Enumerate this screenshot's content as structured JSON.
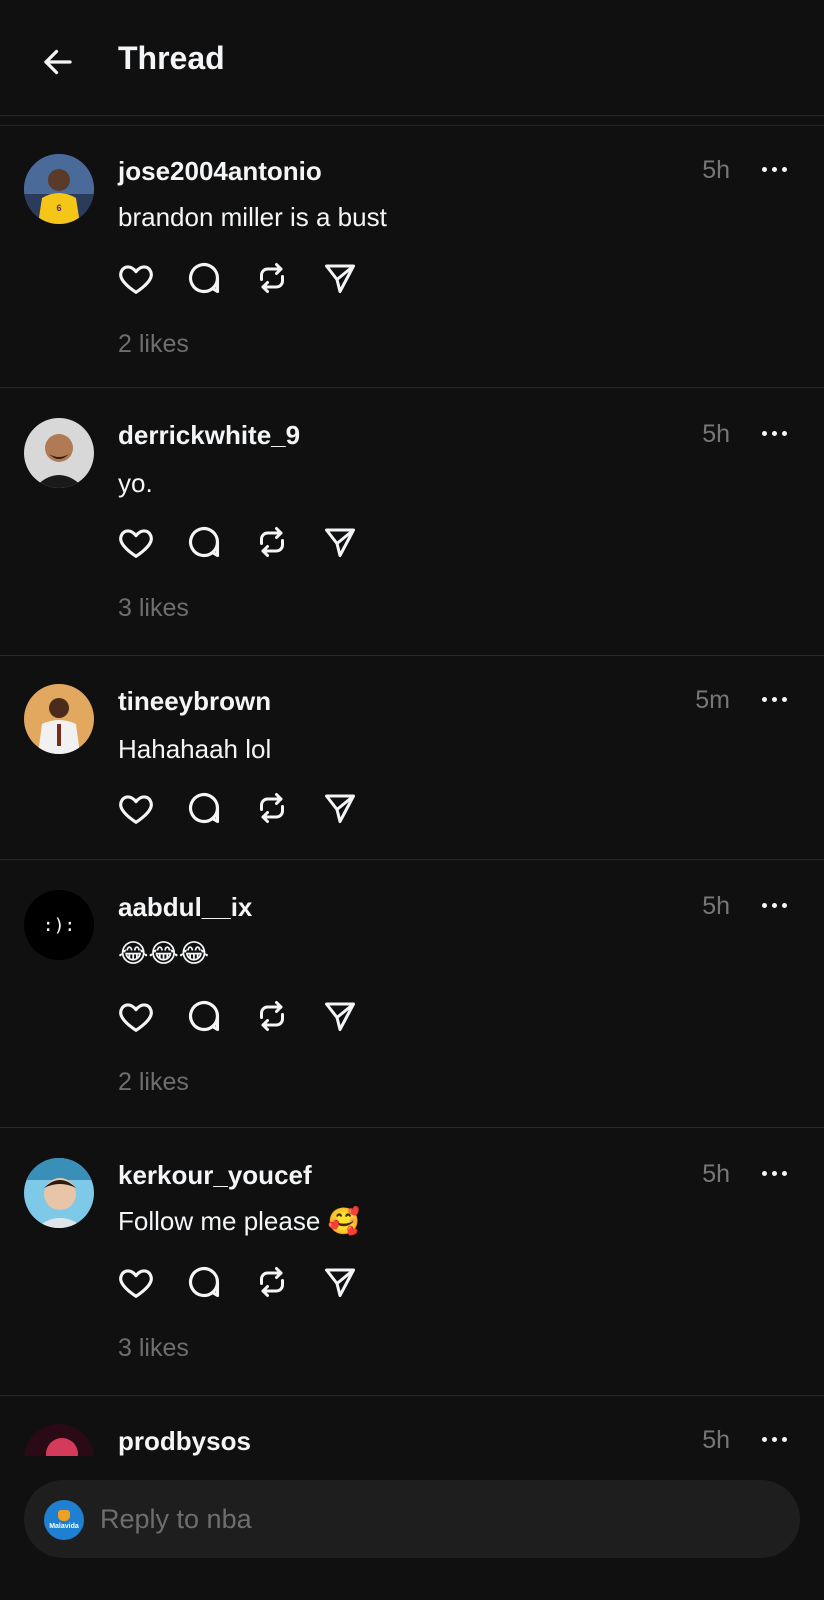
{
  "header": {
    "title": "Thread"
  },
  "posts": [
    {
      "username": "jose2004antonio",
      "time": "5h",
      "text": "brandon miller is a bust",
      "likes": "2 likes"
    },
    {
      "username": "derrickwhite_9",
      "time": "5h",
      "text": "yo.",
      "likes": "3 likes"
    },
    {
      "username": "tineeybrown",
      "time": "5m",
      "text": "Hahahaah lol",
      "likes": ""
    },
    {
      "username": "aabdul__ix",
      "time": "5h",
      "text": "😂😂😂",
      "likes": "2 likes",
      "avatar_text": ":):"
    },
    {
      "username": "kerkour_youcef",
      "time": "5h",
      "text": "Follow me please 🥰",
      "likes": "3 likes"
    },
    {
      "username": "prodbysos",
      "time": "5h",
      "text": "",
      "likes": ""
    }
  ],
  "reply": {
    "placeholder": "Reply to nba",
    "avatar_logo_text": "Malavida"
  },
  "icons": {
    "back": "arrow-left-icon",
    "more": "more-dots-icon",
    "like": "heart-icon",
    "comment": "comment-bubble-icon",
    "repost": "repost-icon",
    "share": "send-icon"
  }
}
